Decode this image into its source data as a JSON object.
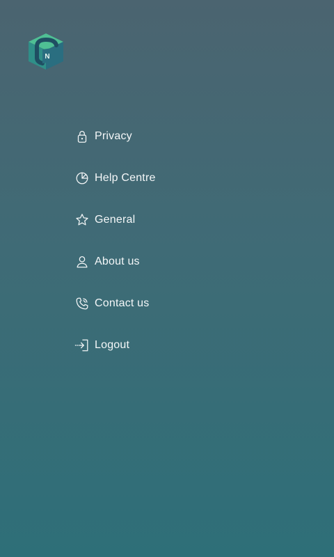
{
  "app": {
    "logo_icon": "brand-cube-logo"
  },
  "menu": {
    "items": [
      {
        "label": "Privacy",
        "icon": "lock-icon"
      },
      {
        "label": "Help Centre",
        "icon": "pie-chart-icon"
      },
      {
        "label": "General",
        "icon": "star-icon"
      },
      {
        "label": "About us",
        "icon": "user-icon"
      },
      {
        "label": "Contact us",
        "icon": "phone-icon"
      },
      {
        "label": "Logout",
        "icon": "logout-icon"
      }
    ]
  },
  "colors": {
    "background_top": "#4b6470",
    "background_bottom": "#2e6f78",
    "logo_primary": "#38a488",
    "logo_dark": "#1f4e62",
    "text": "#f4f7f8"
  }
}
